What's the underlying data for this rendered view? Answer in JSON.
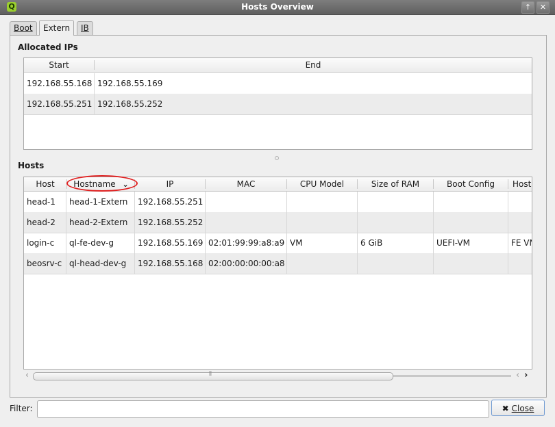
{
  "window": {
    "title": "Hosts Overview",
    "app_icon_letter": "Q",
    "btn_up": "↑",
    "btn_close": "✕"
  },
  "tabs": [
    {
      "label": "Boot",
      "active": false
    },
    {
      "label": "Extern",
      "active": true
    },
    {
      "label": "IB",
      "active": false
    }
  ],
  "allocated": {
    "title": "Allocated IPs",
    "columns": [
      "Start",
      "End"
    ],
    "rows": [
      [
        "192.168.55.168",
        "192.168.55.169"
      ],
      [
        "192.168.55.251",
        "192.168.55.252"
      ]
    ]
  },
  "hosts": {
    "title": "Hosts",
    "columns": [
      "Host",
      "Hostname",
      "IP",
      "MAC",
      "CPU Model",
      "Size of RAM",
      "Boot Config",
      "Host"
    ],
    "sort_indicator": "⌄",
    "rows": [
      [
        "head-1",
        "head-1-Extern",
        "192.168.55.251",
        "",
        "",
        "",
        "",
        ""
      ],
      [
        "head-2",
        "head-2-Extern",
        "192.168.55.252",
        "",
        "",
        "",
        "",
        ""
      ],
      [
        "login-c",
        "ql-fe-dev-g",
        "192.168.55.169",
        "02:01:99:99:a8:a9",
        "VM",
        "6 GiB",
        "UEFI-VM",
        "FE VM"
      ],
      [
        "beosrv-c",
        "ql-head-dev-g",
        "192.168.55.168",
        "02:00:00:00:00:a8",
        "",
        "",
        "",
        ""
      ]
    ]
  },
  "scrollbar": {
    "left_arrow": "‹",
    "right_arrow": "›",
    "grip": "⦀"
  },
  "filter": {
    "label": "Filter:",
    "value": ""
  },
  "close_button": {
    "icon": "✖",
    "label": "Close"
  }
}
